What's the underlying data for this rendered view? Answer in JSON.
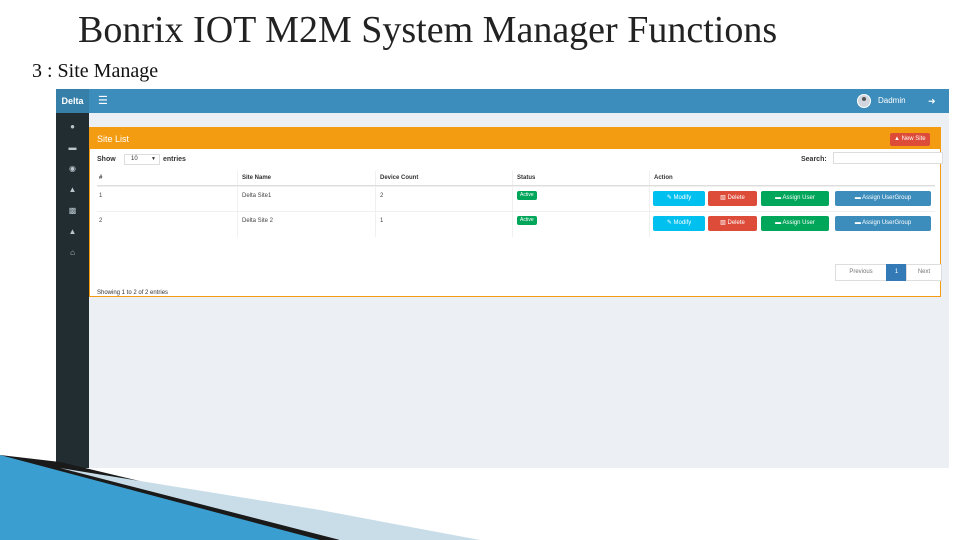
{
  "slide": {
    "title": "Bonrix IOT M2M System Manager Functions",
    "subtitle": "3 : Site Manage"
  },
  "app": {
    "brand": "Delta",
    "user_name": "Dadmin",
    "icons": {
      "menu": "hamburger-icon",
      "logout": "logout-icon",
      "sidebar": [
        "user-icon",
        "car-icon",
        "globe-icon",
        "sitemap-icon",
        "users-icon",
        "bell-icon",
        "key-icon"
      ]
    }
  },
  "box": {
    "title": "Site List",
    "new_button": "New Site"
  },
  "controls": {
    "show": "Show",
    "length_value": "10",
    "entries": "entries",
    "search": "Search:"
  },
  "table": {
    "headers": [
      "#",
      "Site Name",
      "Device Count",
      "Status",
      "Action"
    ],
    "rows": [
      {
        "id": "1",
        "site_name": "Delta Site1",
        "device_count": "2",
        "status": "Active"
      },
      {
        "id": "2",
        "site_name": "Delta Site 2",
        "device_count": "1",
        "status": "Active"
      }
    ],
    "actions": {
      "modify": "Modify",
      "delete": "Delete",
      "assign_user": "Assign User",
      "assign_group": "Assign UserGroup"
    }
  },
  "footer": {
    "info": "Showing 1 to 2 of 2 entries",
    "pagination": {
      "previous": "Previous",
      "page": "1",
      "next": "Next"
    }
  },
  "colors": {
    "header_blue": "#3c8dbc",
    "sidebar_dark": "#222d32",
    "box_orange": "#f39c12",
    "danger_red": "#dd4b39",
    "success_green": "#00a65a",
    "info_cyan": "#00c0ef"
  }
}
